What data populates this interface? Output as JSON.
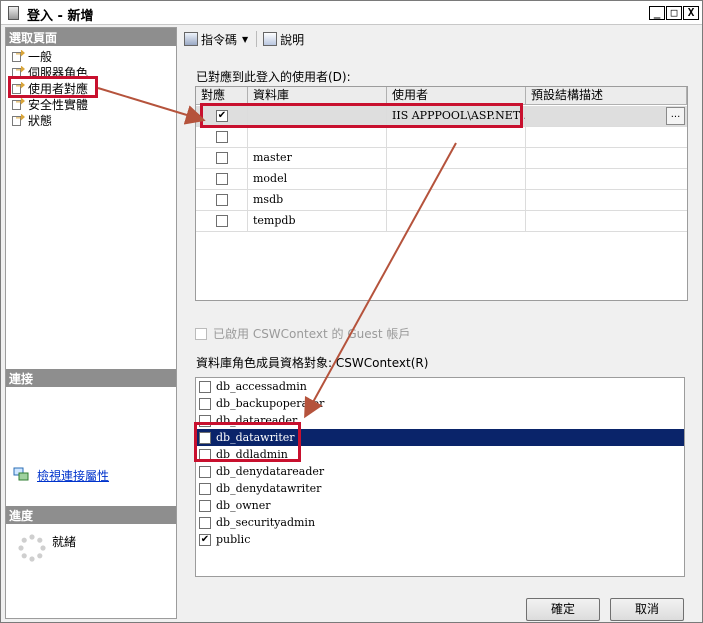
{
  "window": {
    "title": "登入 - 新增",
    "buttons": [
      "_",
      "□",
      "X"
    ]
  },
  "sidebar": {
    "select_page_header": "選取頁面",
    "items": [
      {
        "label": "一般",
        "icon": "page-arrow-icon"
      },
      {
        "label": "伺服器角色",
        "icon": "page-arrow-icon"
      },
      {
        "label": "使用者對應",
        "icon": "page-arrow-icon",
        "selected": true
      },
      {
        "label": "安全性實體",
        "icon": "page-arrow-icon"
      },
      {
        "label": "狀態",
        "icon": "page-arrow-icon"
      }
    ],
    "connection_header": "連接",
    "connection_link": "檢視連接屬性",
    "progress_header": "進度",
    "progress_status": "就緒"
  },
  "toolbar": {
    "script_label": "指令碼",
    "help_label": "說明"
  },
  "mapping": {
    "label": "已對應到此登入的使用者(D):",
    "columns": [
      "對應",
      "資料庫",
      "使用者",
      "預設結構描述"
    ],
    "rows": [
      {
        "mapped": true,
        "database": "",
        "user": "IIS APPPOOL\\ASP.NET ...",
        "schema": "",
        "selected": true
      },
      {
        "mapped": false,
        "database": "",
        "user": "",
        "schema": ""
      },
      {
        "mapped": false,
        "database": "master",
        "user": "",
        "schema": ""
      },
      {
        "mapped": false,
        "database": "model",
        "user": "",
        "schema": ""
      },
      {
        "mapped": false,
        "database": "msdb",
        "user": "",
        "schema": ""
      },
      {
        "mapped": false,
        "database": "tempdb",
        "user": "",
        "schema": ""
      }
    ],
    "ellipsis": "..."
  },
  "guest": {
    "label": "已啟用 CSWContext 的 Guest 帳戶",
    "checked": false,
    "enabled": false
  },
  "roles": {
    "label": "資料庫角色成員資格對象: CSWContext(R)",
    "items": [
      {
        "name": "db_accessadmin",
        "checked": false
      },
      {
        "name": "db_backupoperator",
        "checked": false
      },
      {
        "name": "db_datareader",
        "checked": false
      },
      {
        "name": "db_datawriter",
        "checked": false,
        "selected": true
      },
      {
        "name": "db_ddladmin",
        "checked": false
      },
      {
        "name": "db_denydatareader",
        "checked": false
      },
      {
        "name": "db_denydatawriter",
        "checked": false
      },
      {
        "name": "db_owner",
        "checked": false
      },
      {
        "name": "db_securityadmin",
        "checked": false
      },
      {
        "name": "public",
        "checked": true
      }
    ]
  },
  "footer": {
    "ok_label": "確定",
    "cancel_label": "取消"
  },
  "colors": {
    "selection": "#0a246a",
    "annotation": "#c8102e",
    "arrow": "#b5533c",
    "header_gray": "#8e8e8e"
  }
}
